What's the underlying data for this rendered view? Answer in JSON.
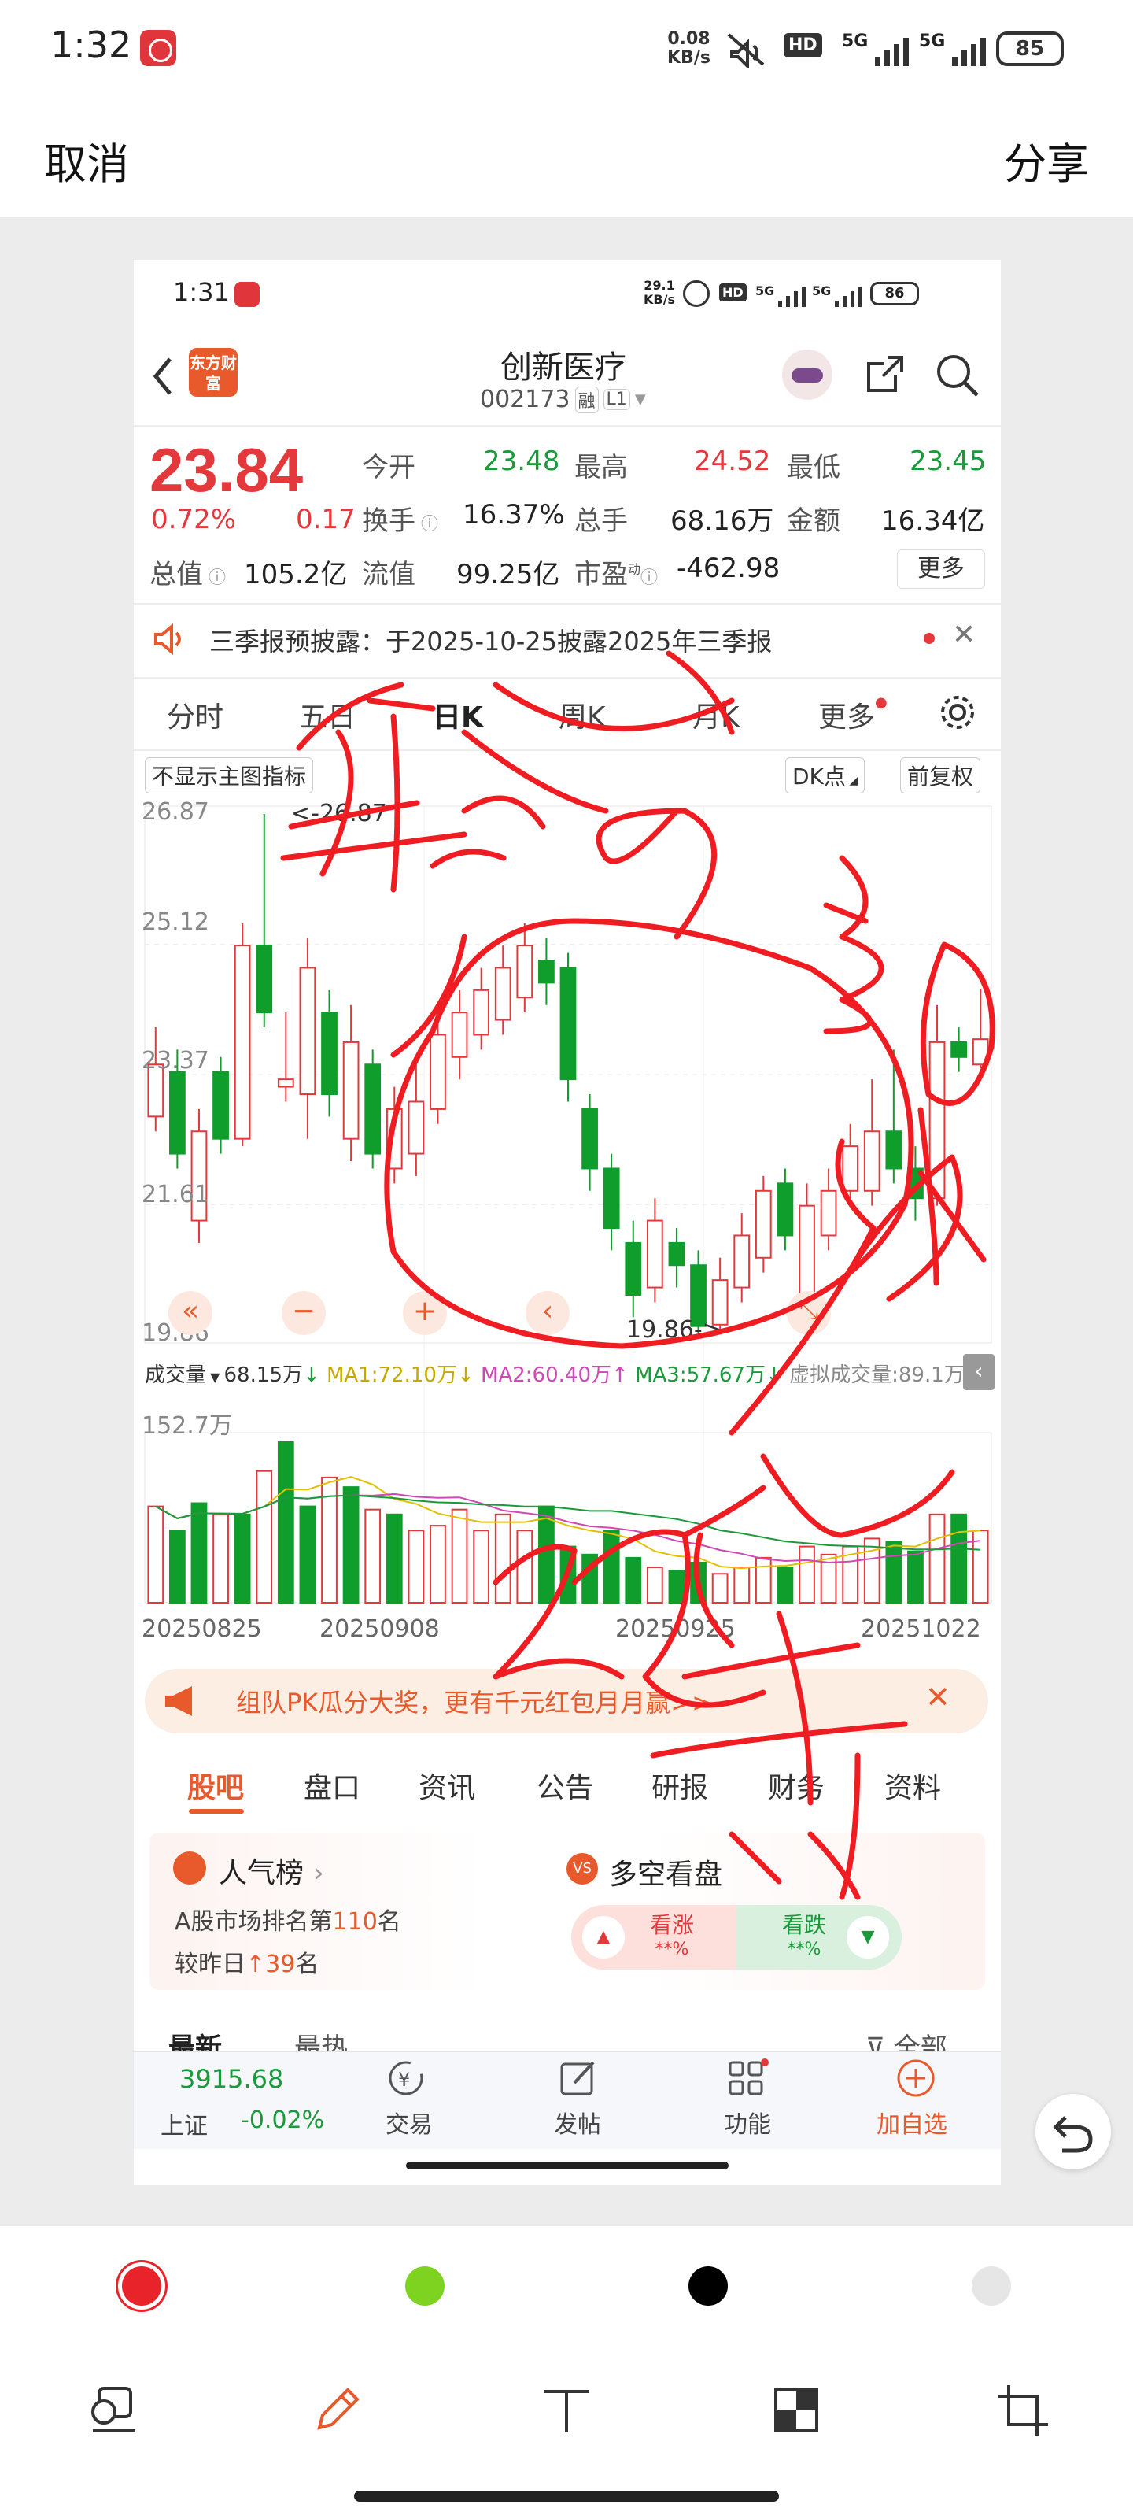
{
  "outer": {
    "time": "1:32",
    "net_speed_top": "0.08",
    "net_speed_unit": "KB/s",
    "battery": "85",
    "signal_label": "5G",
    "cancel": "取消",
    "share": "分享"
  },
  "inner": {
    "time": "1:31",
    "net_speed_top": "29.1",
    "net_speed_unit": "KB/s",
    "battery": "86",
    "signal_label": "5G",
    "logo_text": "东方财富",
    "stock_name": "创新医疗",
    "stock_code": "002173",
    "tag_rong": "融",
    "tag_level": "L1",
    "price": "23.84",
    "change_pct": "0.72%",
    "change_amt": "0.17",
    "quote": {
      "open_label": "今开",
      "open": "23.48",
      "high_label": "最高",
      "high": "24.52",
      "low_label": "最低",
      "low": "23.45",
      "turnover_label": "换手",
      "turnover": "16.37%",
      "volume_label": "总手",
      "volume": "68.16万",
      "amount_label": "金额",
      "amount": "16.34亿",
      "mktcap_label": "总值",
      "mktcap": "105.2亿",
      "float_label": "流值",
      "float": "99.25亿",
      "pe_label": "市盈",
      "pe_sup": "动",
      "pe": "-462.98",
      "more": "更多"
    },
    "notice": "三季报预披露：于2025-10-25披露2025年三季报",
    "chart_tabs": [
      "分时",
      "五日",
      "日K",
      "周K",
      "月K",
      "更多"
    ],
    "chart_opts": {
      "hide_main": "不显示主图指标",
      "dk": "DK点",
      "fq": "前复权"
    },
    "y_ticks": [
      "26.87",
      "25.12",
      "23.37",
      "21.61",
      "19.86"
    ],
    "max_label": "<-26.87",
    "min_label": "19.86->",
    "vol_bar": {
      "label": "成交量",
      "v": "68.15万",
      "ma1": "MA1:72.10万",
      "ma2": "MA2:60.40万",
      "ma3": "MA3:57.67万",
      "virtual": "虚拟成交量:89.1万"
    },
    "vol_max": "152.7万",
    "dates": [
      "20250825",
      "20250908",
      "20250925",
      "20251022"
    ],
    "banner": "组队PK瓜分大奖，更有千元红包月月赢>>",
    "sub_tabs": [
      "股吧",
      "盘口",
      "资讯",
      "公告",
      "研报",
      "财务",
      "资料"
    ],
    "rank": {
      "title": "人气榜",
      "line1_pre": "A股市场排名第",
      "line1_num": "110",
      "line1_post": "名",
      "line2_pre": "较昨日",
      "line2_num": "39",
      "line2_post": "名"
    },
    "vs": {
      "title": "多空看盘",
      "bull": "看涨",
      "bull_val": "**%",
      "bear": "看跌",
      "bear_val": "**%"
    },
    "feed_tabs": {
      "newest": "最新",
      "hottest": "最热",
      "all": "全部"
    },
    "bottom": {
      "index_value": "3915.68",
      "index_name": "上证",
      "index_change": "-0.02%",
      "trade": "交易",
      "post": "发帖",
      "func": "功能",
      "add": "加自选"
    }
  },
  "chart_data": {
    "type": "candlestick",
    "ylim": [
      19.86,
      26.87
    ],
    "x_labels": [
      "20250825",
      "20250908",
      "20250925",
      "20251022"
    ],
    "candles": [
      {
        "o": 22.8,
        "c": 23.5,
        "h": 24.0,
        "l": 22.6,
        "dir": "up"
      },
      {
        "o": 23.4,
        "c": 22.3,
        "h": 23.7,
        "l": 22.1,
        "dir": "down"
      },
      {
        "o": 21.4,
        "c": 22.6,
        "h": 22.9,
        "l": 21.1,
        "dir": "up"
      },
      {
        "o": 23.4,
        "c": 22.5,
        "h": 23.6,
        "l": 22.3,
        "dir": "down"
      },
      {
        "o": 22.5,
        "c": 25.1,
        "h": 25.4,
        "l": 22.4,
        "dir": "up"
      },
      {
        "o": 25.1,
        "c": 24.2,
        "h": 26.87,
        "l": 24.0,
        "dir": "down"
      },
      {
        "o": 23.3,
        "c": 23.2,
        "h": 24.2,
        "l": 23.0,
        "dir": "up"
      },
      {
        "o": 23.1,
        "c": 24.8,
        "h": 25.2,
        "l": 22.5,
        "dir": "up"
      },
      {
        "o": 24.2,
        "c": 23.1,
        "h": 24.5,
        "l": 22.8,
        "dir": "down"
      },
      {
        "o": 22.5,
        "c": 23.8,
        "h": 24.3,
        "l": 22.2,
        "dir": "up"
      },
      {
        "o": 23.5,
        "c": 22.3,
        "h": 23.7,
        "l": 22.1,
        "dir": "down"
      },
      {
        "o": 22.1,
        "c": 22.9,
        "h": 23.2,
        "l": 21.9,
        "dir": "up"
      },
      {
        "o": 22.3,
        "c": 23.0,
        "h": 23.6,
        "l": 22.0,
        "dir": "up"
      },
      {
        "o": 22.9,
        "c": 23.9,
        "h": 24.3,
        "l": 22.7,
        "dir": "up"
      },
      {
        "o": 23.6,
        "c": 24.2,
        "h": 24.5,
        "l": 23.3,
        "dir": "up"
      },
      {
        "o": 23.9,
        "c": 24.5,
        "h": 24.8,
        "l": 23.7,
        "dir": "up"
      },
      {
        "o": 24.1,
        "c": 24.8,
        "h": 25.1,
        "l": 23.9,
        "dir": "up"
      },
      {
        "o": 24.4,
        "c": 25.1,
        "h": 25.4,
        "l": 24.2,
        "dir": "up"
      },
      {
        "o": 24.9,
        "c": 24.6,
        "h": 25.2,
        "l": 24.3,
        "dir": "down"
      },
      {
        "o": 24.8,
        "c": 23.3,
        "h": 25.0,
        "l": 23.0,
        "dir": "down"
      },
      {
        "o": 22.9,
        "c": 22.1,
        "h": 23.1,
        "l": 21.8,
        "dir": "down"
      },
      {
        "o": 22.1,
        "c": 21.3,
        "h": 22.3,
        "l": 21.0,
        "dir": "down"
      },
      {
        "o": 21.1,
        "c": 20.4,
        "h": 21.4,
        "l": 20.1,
        "dir": "down"
      },
      {
        "o": 20.5,
        "c": 21.4,
        "h": 21.7,
        "l": 20.3,
        "dir": "up"
      },
      {
        "o": 21.1,
        "c": 20.8,
        "h": 21.3,
        "l": 20.5,
        "dir": "down"
      },
      {
        "o": 20.8,
        "c": 19.98,
        "h": 21.0,
        "l": 19.86,
        "dir": "down"
      },
      {
        "o": 20.0,
        "c": 20.6,
        "h": 20.9,
        "l": 19.9,
        "dir": "up"
      },
      {
        "o": 20.5,
        "c": 21.2,
        "h": 21.5,
        "l": 20.3,
        "dir": "up"
      },
      {
        "o": 20.9,
        "c": 21.8,
        "h": 22.0,
        "l": 20.7,
        "dir": "up"
      },
      {
        "o": 21.9,
        "c": 21.2,
        "h": 22.1,
        "l": 21.0,
        "dir": "down"
      },
      {
        "o": 20.2,
        "c": 21.6,
        "h": 21.9,
        "l": 19.9,
        "dir": "up"
      },
      {
        "o": 21.2,
        "c": 21.8,
        "h": 22.1,
        "l": 21.0,
        "dir": "up"
      },
      {
        "o": 21.8,
        "c": 22.4,
        "h": 22.7,
        "l": 21.6,
        "dir": "up"
      },
      {
        "o": 21.8,
        "c": 22.6,
        "h": 23.3,
        "l": 21.6,
        "dir": "up"
      },
      {
        "o": 22.6,
        "c": 22.1,
        "h": 23.7,
        "l": 21.9,
        "dir": "down"
      },
      {
        "o": 22.1,
        "c": 21.7,
        "h": 22.4,
        "l": 21.4,
        "dir": "down"
      },
      {
        "o": 21.7,
        "c": 23.8,
        "h": 24.3,
        "l": 21.6,
        "dir": "up"
      },
      {
        "o": 23.8,
        "c": 23.6,
        "h": 24.0,
        "l": 23.4,
        "dir": "down"
      },
      {
        "o": 23.5,
        "c": 23.84,
        "h": 24.52,
        "l": 23.45,
        "dir": "up"
      }
    ],
    "volume_max": "152.7万",
    "volumes": [
      {
        "v": 0.6,
        "dir": "up"
      },
      {
        "v": 0.45,
        "dir": "down"
      },
      {
        "v": 0.62,
        "dir": "down"
      },
      {
        "v": 0.55,
        "dir": "up"
      },
      {
        "v": 0.55,
        "dir": "down"
      },
      {
        "v": 0.82,
        "dir": "up"
      },
      {
        "v": 1.0,
        "dir": "down"
      },
      {
        "v": 0.6,
        "dir": "down"
      },
      {
        "v": 0.78,
        "dir": "up"
      },
      {
        "v": 0.72,
        "dir": "down"
      },
      {
        "v": 0.58,
        "dir": "up"
      },
      {
        "v": 0.55,
        "dir": "down"
      },
      {
        "v": 0.45,
        "dir": "up"
      },
      {
        "v": 0.48,
        "dir": "up"
      },
      {
        "v": 0.58,
        "dir": "up"
      },
      {
        "v": 0.45,
        "dir": "up"
      },
      {
        "v": 0.55,
        "dir": "up"
      },
      {
        "v": 0.45,
        "dir": "up"
      },
      {
        "v": 0.6,
        "dir": "down"
      },
      {
        "v": 0.35,
        "dir": "down"
      },
      {
        "v": 0.3,
        "dir": "down"
      },
      {
        "v": 0.45,
        "dir": "down"
      },
      {
        "v": 0.28,
        "dir": "down"
      },
      {
        "v": 0.22,
        "dir": "up"
      },
      {
        "v": 0.2,
        "dir": "down"
      },
      {
        "v": 0.25,
        "dir": "down"
      },
      {
        "v": 0.18,
        "dir": "up"
      },
      {
        "v": 0.22,
        "dir": "up"
      },
      {
        "v": 0.28,
        "dir": "up"
      },
      {
        "v": 0.22,
        "dir": "down"
      },
      {
        "v": 0.35,
        "dir": "up"
      },
      {
        "v": 0.3,
        "dir": "up"
      },
      {
        "v": 0.35,
        "dir": "up"
      },
      {
        "v": 0.4,
        "dir": "up"
      },
      {
        "v": 0.38,
        "dir": "down"
      },
      {
        "v": 0.32,
        "dir": "down"
      },
      {
        "v": 0.55,
        "dir": "up"
      },
      {
        "v": 0.55,
        "dir": "down"
      },
      {
        "v": 0.45,
        "dir": "up"
      }
    ]
  },
  "toolbar": {
    "colors": [
      "#e8232a",
      "#7ed321",
      "#000000",
      "#e6e6e6"
    ],
    "tools": [
      "copy-icon",
      "pen-icon",
      "text-icon",
      "mosaic-icon",
      "crop-icon"
    ]
  }
}
